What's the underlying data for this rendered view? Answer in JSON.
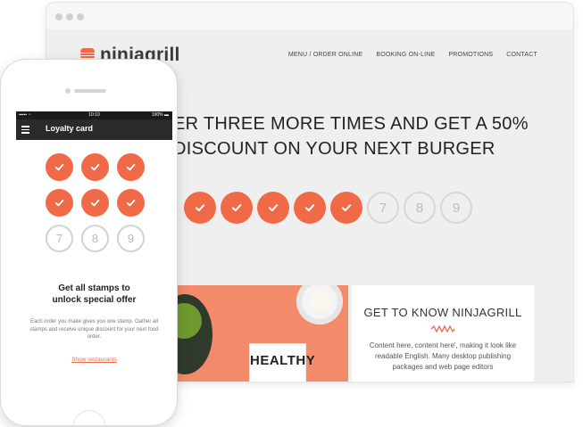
{
  "brand": {
    "name": "ninjagrill",
    "accent": "#f06a47"
  },
  "desktop": {
    "nav": [
      "MENU / ORDER ONLINE",
      "BOOKING ON-LINE",
      "PROMOTIONS",
      "CONTACT"
    ],
    "hero": {
      "line1": "ER THREE MORE TIMES AND GET A 50%",
      "line2": "DISCOUNT ON YOUR NEXT BURGER"
    },
    "stamps": {
      "filled": 5,
      "empty_numbers": [
        "7",
        "8",
        "9"
      ]
    },
    "food_card_text": "HEALTHY",
    "about": {
      "title": "GET TO KNOW NINJAGRILL",
      "body": "Content here, content here', making it look like readable English. Many desktop publishing packages and web page editors"
    }
  },
  "mobile": {
    "status": {
      "signal": "▪▪▪▪▪ ◔",
      "time": "10:10",
      "battery": "100% ▬"
    },
    "app_title": "Loyalty card",
    "stamps": {
      "filled": 6,
      "empty_numbers": [
        "7",
        "8",
        "9"
      ]
    },
    "unlock_title": "Get all stamps to unlock special offer",
    "unlock_body": "Each order you make gives you one stamp. Gather all stamps and receive unique discount for your next food order.",
    "link": "Show restaurants"
  }
}
